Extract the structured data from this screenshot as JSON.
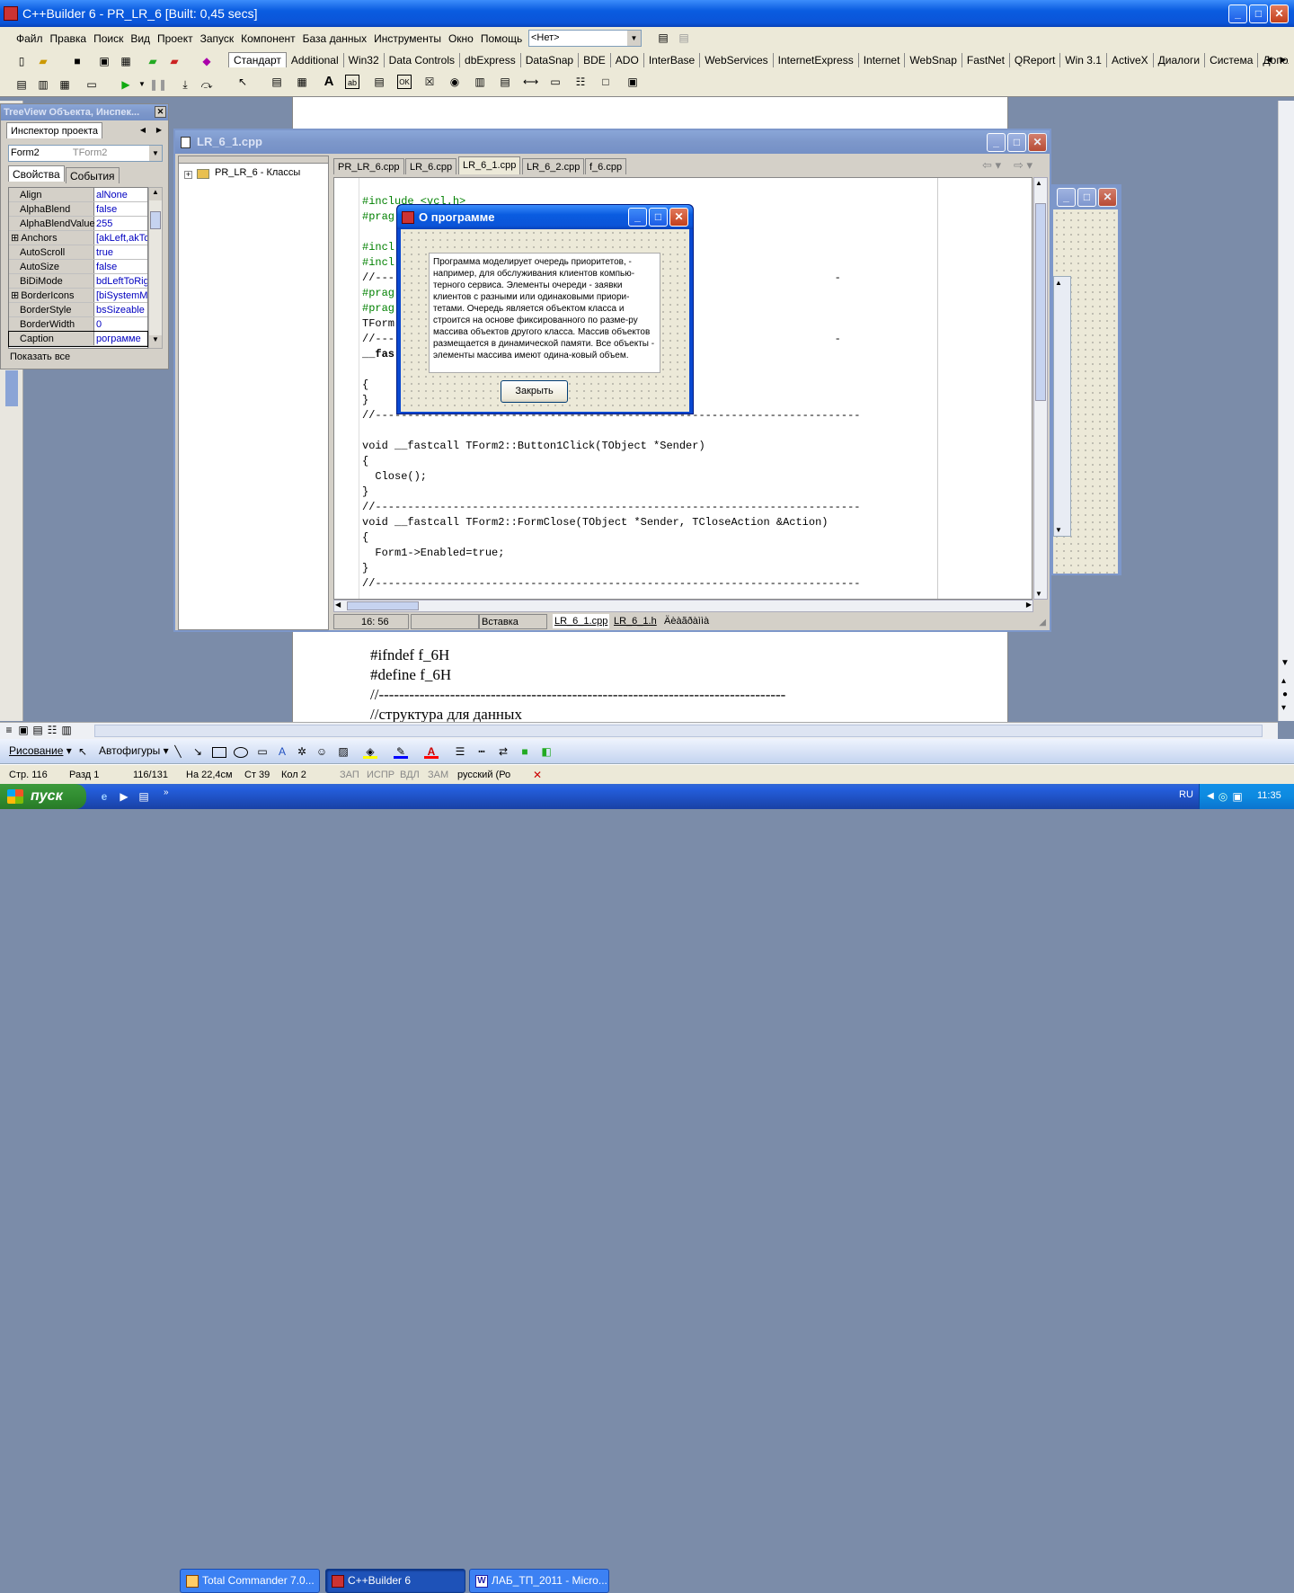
{
  "main_window": {
    "title": "C++Builder 6 - PR_LR_6 [Built: 0,45 secs]"
  },
  "menu": [
    "Файл",
    "Правка",
    "Поиск",
    "Вид",
    "Проект",
    "Запуск",
    "Компонент",
    "База данных",
    "Инструменты",
    "Окно",
    "Помощь"
  ],
  "config_combo": "<Нет>",
  "palette_tabs": [
    "Стандарт",
    "Additional",
    "Win32",
    "Data Controls",
    "dbExpress",
    "DataSnap",
    "BDE",
    "ADO",
    "InterBase",
    "WebServices",
    "InternetExpress",
    "Internet",
    "WebSnap",
    "FastNet",
    "QReport",
    "Win 3.1",
    "ActiveX",
    "Диалоги",
    "Система",
    "Дополнител"
  ],
  "inspector": {
    "title": "TreeView Объекта, Инспек...",
    "tab": "Инспектор проекта",
    "object_name": "Form2",
    "object_type": "TForm2",
    "tabs": [
      "Свойства",
      "События"
    ],
    "props": [
      {
        "name": "Align",
        "value": "alNone",
        "plus": false
      },
      {
        "name": "AlphaBlend",
        "value": "false",
        "plus": false
      },
      {
        "name": "AlphaBlendValue",
        "value": "255",
        "plus": false
      },
      {
        "name": "Anchors",
        "value": "[akLeft,akTo",
        "plus": true
      },
      {
        "name": "AutoScroll",
        "value": "true",
        "plus": false
      },
      {
        "name": "AutoSize",
        "value": "false",
        "plus": false
      },
      {
        "name": "BiDiMode",
        "value": "bdLeftToRig",
        "plus": false
      },
      {
        "name": "BorderIcons",
        "value": "[biSystemMe",
        "plus": true
      },
      {
        "name": "BorderStyle",
        "value": "bsSizeable",
        "plus": false
      },
      {
        "name": "BorderWidth",
        "value": "0",
        "plus": false
      },
      {
        "name": "Caption",
        "value": "рограмме",
        "plus": false
      }
    ],
    "footer": "Показать все"
  },
  "editor": {
    "title": "LR_6_1.cpp",
    "tree_node": "PR_LR_6 - Классы",
    "tabs": [
      "PR_LR_6.cpp",
      "LR_6.cpp",
      "LR_6_1.cpp",
      "LR_6_2.cpp",
      "f_6.cpp"
    ],
    "status_pos": "16: 56",
    "status_mode": "Вставка",
    "bottom_tabs": [
      "LR_6_1.cpp",
      "LR_6_1.h",
      "Äèàãðàììà"
    ]
  },
  "code": [
    {
      "t": "#include <vcl.h>",
      "c": "gr"
    },
    {
      "t": "#prag",
      "c": "gr"
    },
    {
      "t": "",
      "c": ""
    },
    {
      "t": "#incl",
      "c": "gr"
    },
    {
      "t": "#incl",
      "c": "gr"
    },
    {
      "t": "//----                                                                   -",
      "c": ""
    },
    {
      "t": "#prag",
      "c": "gr"
    },
    {
      "t": "#prag",
      "c": "gr"
    },
    {
      "t": "TForm",
      "c": ""
    },
    {
      "t": "//----                                                                   -",
      "c": ""
    },
    {
      "t": "__fas",
      "c": "b"
    },
    {
      "t": "",
      "c": ""
    },
    {
      "t": "{",
      "c": ""
    },
    {
      "t": "}",
      "c": ""
    },
    {
      "t": "//---------------------------------------------------------------------------",
      "c": ""
    },
    {
      "t": "",
      "c": ""
    },
    {
      "t": "void __fastcall TForm2::Button1Click(TObject *Sender)",
      "c": ""
    },
    {
      "t": "{",
      "c": ""
    },
    {
      "t": "  Close();",
      "c": ""
    },
    {
      "t": "}",
      "c": ""
    },
    {
      "t": "//---------------------------------------------------------------------------",
      "c": ""
    },
    {
      "t": "void __fastcall TForm2::FormClose(TObject *Sender, TCloseAction &Action)",
      "c": ""
    },
    {
      "t": "{",
      "c": ""
    },
    {
      "t": "  Form1->Enabled=true;",
      "c": ""
    },
    {
      "t": "}",
      "c": ""
    },
    {
      "t": "//---------------------------------------------------------------------------",
      "c": ""
    }
  ],
  "dialog": {
    "title": "О программе",
    "text": "Программа моделирует очередь приоритетов, - например, для обслуживания клиентов компью-терного сервиса. Элементы очереди - заявки клиентов с разными или одинаковыми приори-тетами. Очередь является объектом класса и строится на основе фиксированного по разме-ру массива объектов другого класса. Массив объектов размещается в динамической памяти. Все объекты - элементы массива имеют одина-ковый объем.",
    "close_button": "Закрыть"
  },
  "word_doc": [
    "#ifndef f_6H",
    "#define f_6H",
    "//--------------------------------------------------------------------------------",
    "//структура для данных"
  ],
  "drawing_bar": {
    "draw": "Рисование",
    "autoshapes": "Автофигуры"
  },
  "word_status": [
    "Стр. 116",
    "Разд 1",
    "116/131",
    "На 22,4см",
    "Ст 39",
    "Кол 2",
    "ЗАП",
    "ИСПР",
    "ВДЛ",
    "ЗАМ",
    "русский (Ро"
  ],
  "taskbar": {
    "start": "пуск",
    "items": [
      "Total Commander 7.0...",
      "C++Builder 6",
      "ЛАБ_ТП_2011 - Micro..."
    ],
    "lang": "RU",
    "time": "11:35"
  }
}
